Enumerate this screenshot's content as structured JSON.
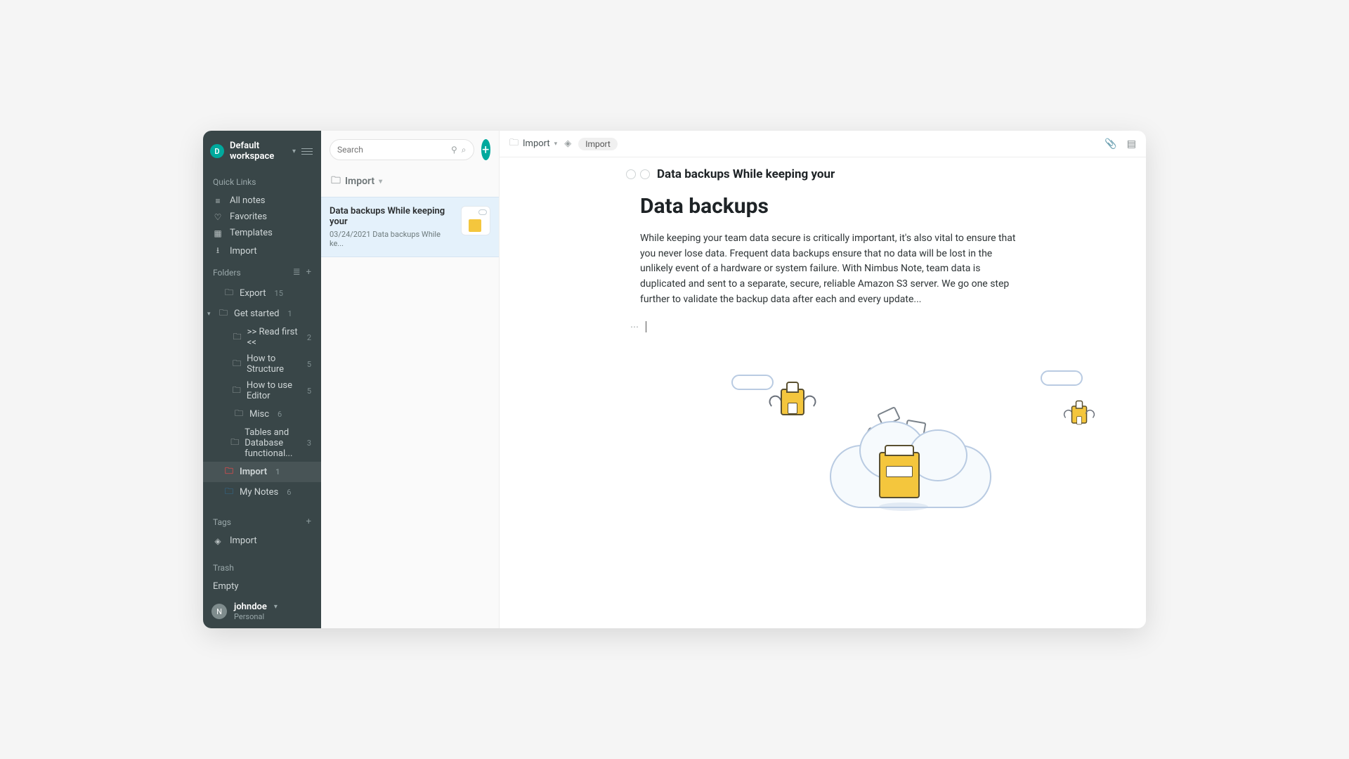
{
  "workspace": {
    "avatar_letter": "D",
    "name": "Default workspace"
  },
  "quicklinks": {
    "title": "Quick Links",
    "items": [
      {
        "icon": "list",
        "label": "All notes"
      },
      {
        "icon": "heart",
        "label": "Favorites"
      },
      {
        "icon": "clip",
        "label": "Templates"
      },
      {
        "icon": "download",
        "label": "Import"
      }
    ]
  },
  "folders": {
    "title": "Folders",
    "items": [
      {
        "label": "Export",
        "count": "15",
        "indent": 0,
        "expanded": false,
        "color": ""
      },
      {
        "label": "Get started",
        "count": "1",
        "indent": 0,
        "expanded": true,
        "color": ""
      },
      {
        "label": ">> Read first <<",
        "count": "2",
        "indent": 1,
        "expanded": false,
        "color": ""
      },
      {
        "label": "How to Structure",
        "count": "5",
        "indent": 1,
        "expanded": false,
        "color": ""
      },
      {
        "label": "How to use Editor",
        "count": "5",
        "indent": 1,
        "expanded": false,
        "color": ""
      },
      {
        "label": "Misc",
        "count": "6",
        "indent": 1,
        "expanded": false,
        "color": ""
      },
      {
        "label": "Tables and Database functional...",
        "count": "3",
        "indent": 1,
        "expanded": false,
        "color": ""
      },
      {
        "label": "Import",
        "count": "1",
        "indent": 0,
        "expanded": false,
        "color": "red",
        "active": true
      },
      {
        "label": "My Notes",
        "count": "6",
        "indent": 0,
        "expanded": false,
        "color": "blue"
      }
    ]
  },
  "tags": {
    "title": "Tags",
    "items": [
      {
        "label": "Import"
      }
    ]
  },
  "trash": {
    "title": "Trash",
    "empty_label": "Empty"
  },
  "user": {
    "avatar_letter": "N",
    "name": "johndoe",
    "plan": "Personal"
  },
  "mid": {
    "search_placeholder": "Search",
    "folder_label": "Import",
    "note": {
      "title": "Data backups While keeping your",
      "date": "03/24/2021",
      "snippet": "Data backups While ke..."
    }
  },
  "topbar": {
    "breadcrumb": "Import",
    "tag": "Import"
  },
  "page": {
    "title": "Data backups While keeping your",
    "heading": "Data backups",
    "body": "While keeping your team data secure is critically important, it's also vital to ensure that you never lose data. Frequent data backups ensure that no data will be lost in the unlikely event of a hardware or system failure. With Nimbus Note, team data is duplicated and sent to a separate, secure, reliable Amazon S3 server. We go one step further to validate the backup data after each and every update..."
  }
}
